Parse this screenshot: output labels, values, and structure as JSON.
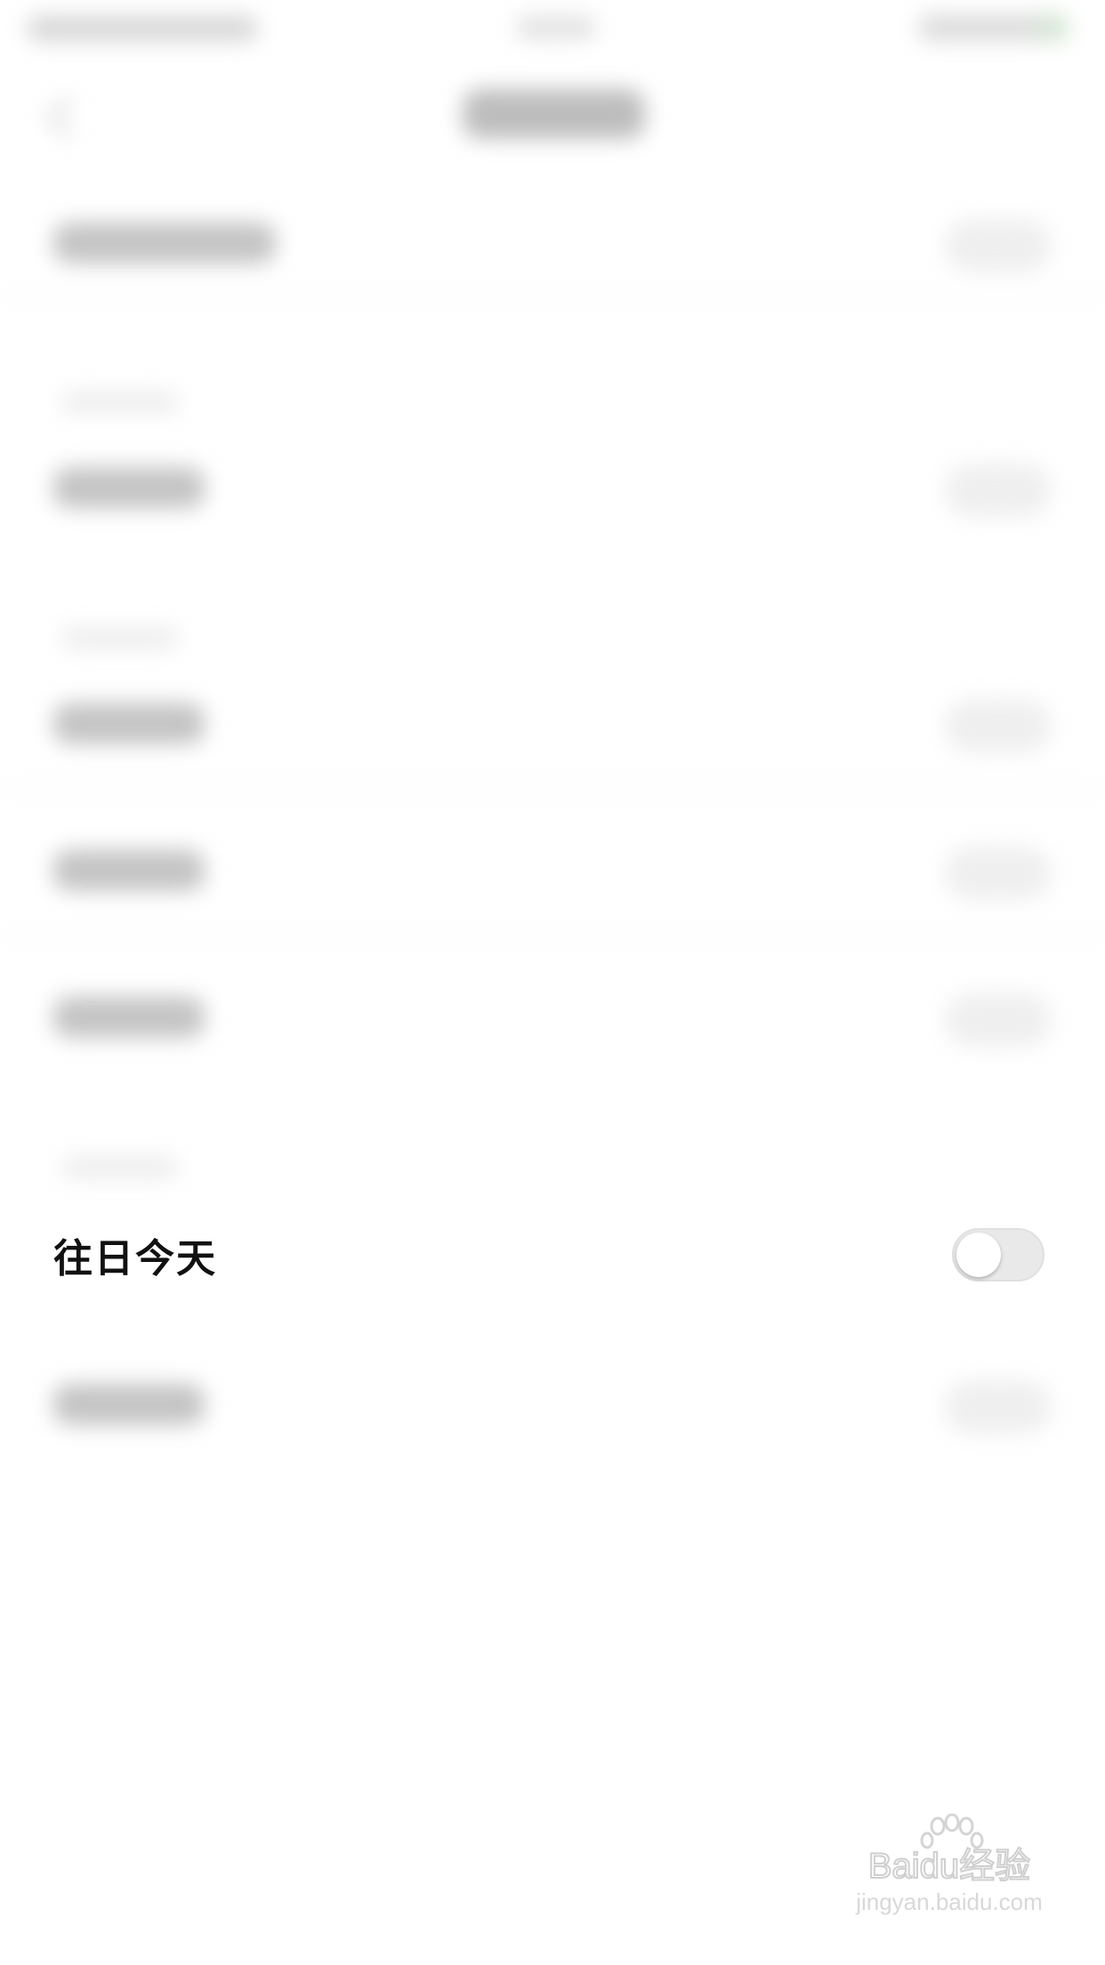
{
  "focused_setting": {
    "label": "往日今天",
    "toggle_on": false
  },
  "watermark": {
    "brand": "Baidu经验",
    "url": "jingyan.baidu.com"
  },
  "colors": {
    "toggle_track_off": "#e9e9e9",
    "toggle_knob": "#ffffff",
    "status_accent": "#cfe9cf"
  }
}
